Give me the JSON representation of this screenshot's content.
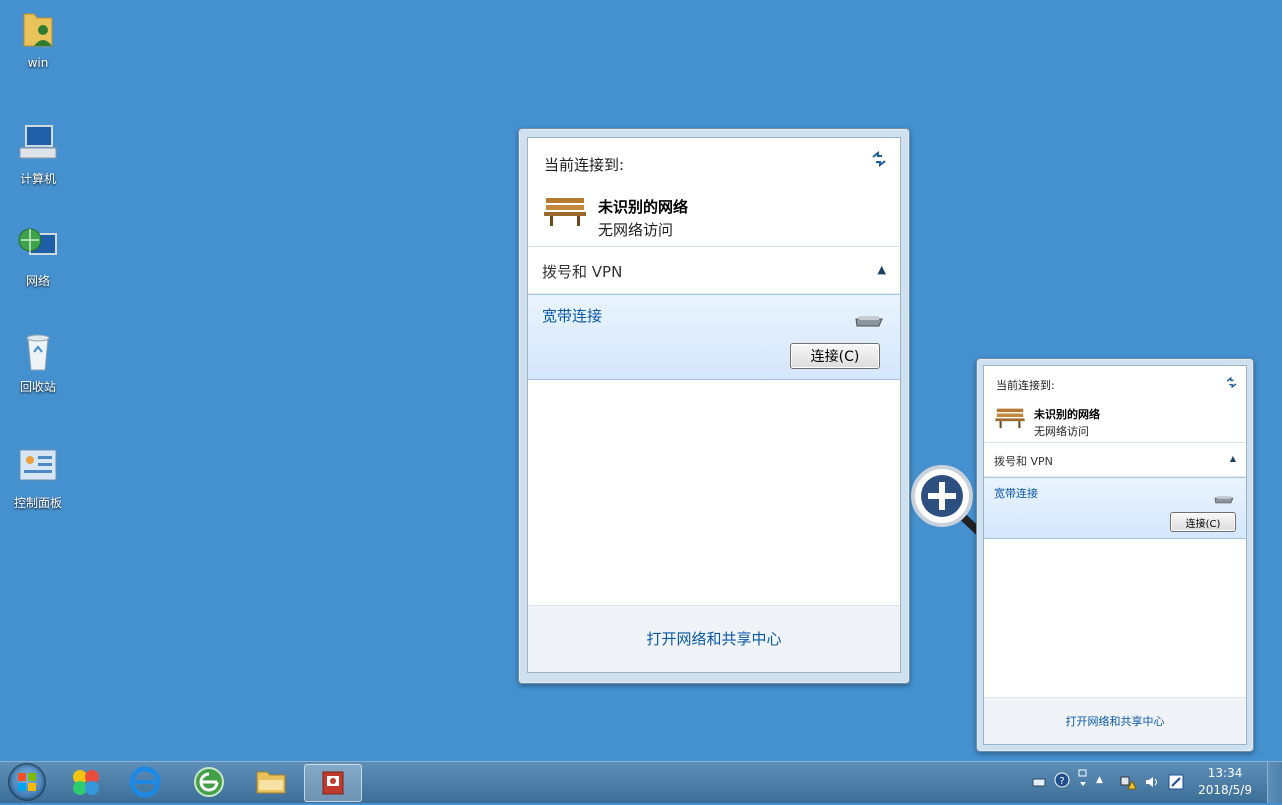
{
  "desktop": {
    "icons": [
      {
        "label": "win"
      },
      {
        "label": "计算机"
      },
      {
        "label": "网络"
      },
      {
        "label": "回收站"
      },
      {
        "label": "控制面板"
      }
    ]
  },
  "flyout": {
    "title": "当前连接到:",
    "network_name": "未识别的网络",
    "network_status": "无网络访问",
    "section_label": "拨号和 VPN",
    "connection_name": "宽带连接",
    "connect_button": "连接(C)",
    "footer_link": "打开网络和共享中心"
  },
  "taskbar": {
    "time": "13:34",
    "date": "2018/5/9"
  },
  "colors": {
    "desktop": "#4591d0",
    "link": "#0a58a8",
    "selected_row": "#d5e7fb"
  }
}
